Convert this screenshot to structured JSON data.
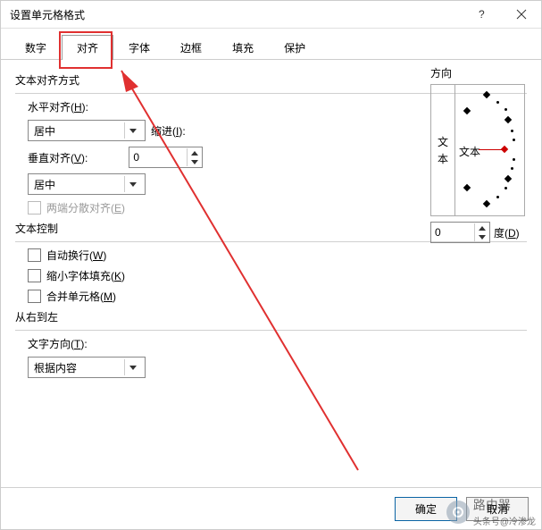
{
  "window": {
    "title": "设置单元格格式"
  },
  "tabs": {
    "items": [
      {
        "label": "数字"
      },
      {
        "label": "对齐"
      },
      {
        "label": "字体"
      },
      {
        "label": "边框"
      },
      {
        "label": "填充"
      },
      {
        "label": "保护"
      }
    ],
    "active_index": 1
  },
  "alignment": {
    "section_label": "文本对齐方式",
    "horizontal_label": "水平对齐(",
    "horizontal_key": "H",
    "horizontal_label2": "):",
    "horizontal_value": "居中",
    "indent_label": "缩进(",
    "indent_key": "I",
    "indent_label2": "):",
    "indent_value": "0",
    "vertical_label": "垂直对齐(",
    "vertical_key": "V",
    "vertical_label2": "):",
    "vertical_value": "居中",
    "justify_distributed_label": "两端分散对齐(",
    "justify_distributed_key": "E",
    "justify_distributed_label2": ")"
  },
  "text_control": {
    "section_label": "文本控制",
    "wrap_label": "自动换行(",
    "wrap_key": "W",
    "wrap_label2": ")",
    "shrink_label": "缩小字体填充(",
    "shrink_key": "K",
    "shrink_label2": ")",
    "merge_label": "合并单元格(",
    "merge_key": "M",
    "merge_label2": ")"
  },
  "rtl": {
    "section_label": "从右到左",
    "dir_label": "文字方向(",
    "dir_key": "T",
    "dir_label2": "):",
    "dir_value": "根据内容"
  },
  "orientation": {
    "section_label": "方向",
    "vchar1": "文",
    "vchar2": "本",
    "dial_label": "文本",
    "degrees_value": "0",
    "degrees_label": "度(",
    "degrees_key": "D",
    "degrees_label2": ")"
  },
  "footer": {
    "ok": "确定",
    "cancel": "取消"
  },
  "watermark": {
    "line1": "路由器",
    "line2": "头条号@冷渗龙"
  }
}
